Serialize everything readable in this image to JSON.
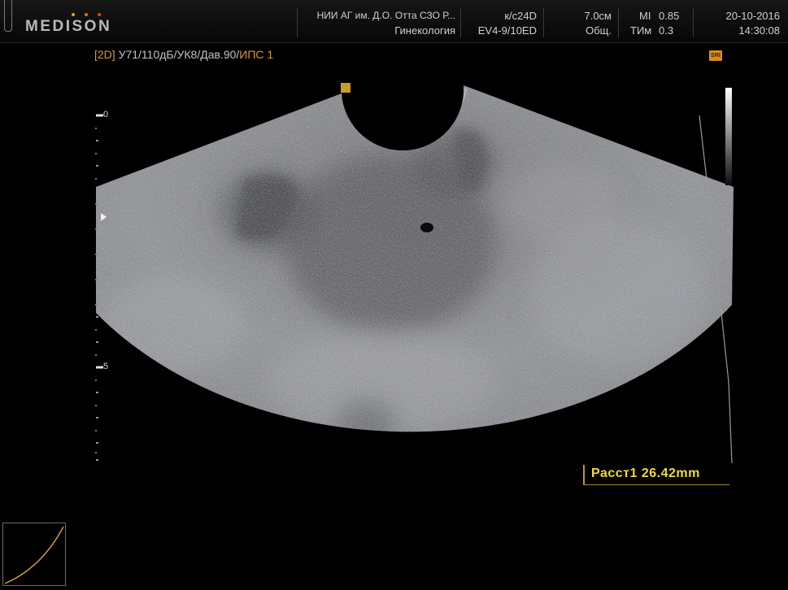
{
  "header": {
    "brand": "MEDISON",
    "institution": "НИИ АГ им. Д.О. Отта СЗО Р...",
    "department": "Гинекология",
    "preset": "к/с24D",
    "probe": "EV4-9/10ED",
    "depth": "7.0см",
    "mode_general": "Общ.",
    "mi_label": "MI",
    "mi_value": "0.85",
    "ti_label": "ТИм",
    "ti_value": "0.3",
    "date": "20-10-2016",
    "time": "14:30:08"
  },
  "params": {
    "mode": "[2D]",
    "settings": "У71/110дБ/УК8/Дав.90/",
    "ips": "ИПС 1"
  },
  "sri_badge": "SRI",
  "depth_scale": {
    "labels": [
      "0",
      "5"
    ]
  },
  "measurement": {
    "label": "Расст1",
    "value": "26.42mm"
  },
  "colors": {
    "measurement_text": "#f2d93a",
    "accent_orange": "#d89a2a"
  }
}
